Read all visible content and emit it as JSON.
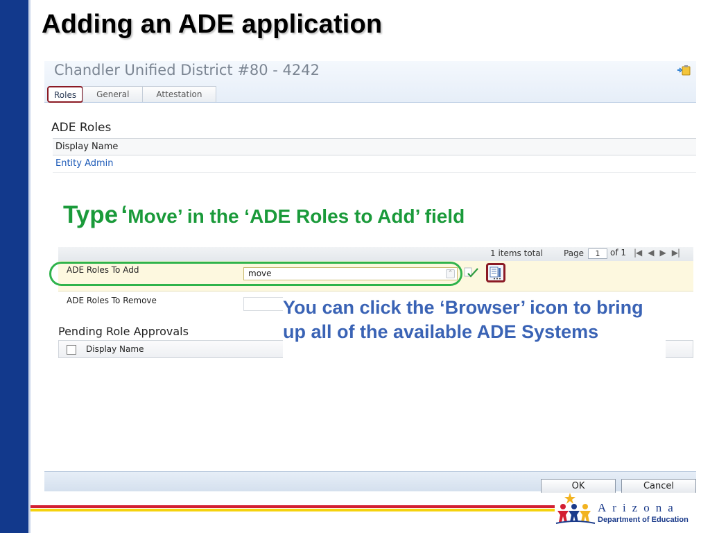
{
  "slide": {
    "title": "Adding an ADE application",
    "instruction_type": "Type",
    "instruction_quote": "‘",
    "instruction_rest": "Move’ in the ‘ADE Roles to Add’ field",
    "callout": "You can click the ‘Browser’ icon to bring up all of the available ADE Systems"
  },
  "window": {
    "entity_title": "Chandler Unified District #80 - 4242",
    "tabs": [
      {
        "label": "Roles",
        "active": true
      },
      {
        "label": "General",
        "active": false
      },
      {
        "label": "Attestation",
        "active": false
      }
    ]
  },
  "ade_roles": {
    "section_title": "ADE Roles",
    "column_header": "Display Name",
    "rows": [
      "Entity Admin"
    ]
  },
  "pager": {
    "total": "1 items total",
    "page_label": "Page",
    "page_value": "1",
    "of_label": "of 1"
  },
  "roles_to_add": {
    "label": "ADE Roles To Add",
    "value": "move"
  },
  "roles_to_remove": {
    "label": "ADE Roles To Remove"
  },
  "pending": {
    "title": "Pending Role Approvals",
    "column_header": "Display Name"
  },
  "buttons": {
    "ok": "OK",
    "cancel": "Cancel"
  },
  "logo": {
    "name": "Arizona",
    "sub": "Department of Education"
  },
  "colors": {
    "sidebar": "#12398c",
    "instruction": "#1a9a3a",
    "callout": "#3a63b5",
    "highlight_oval": "#2fb34b",
    "browser_outline": "#8b1a24",
    "rule_red": "#d31f32",
    "rule_yellow": "#f5d20d"
  }
}
